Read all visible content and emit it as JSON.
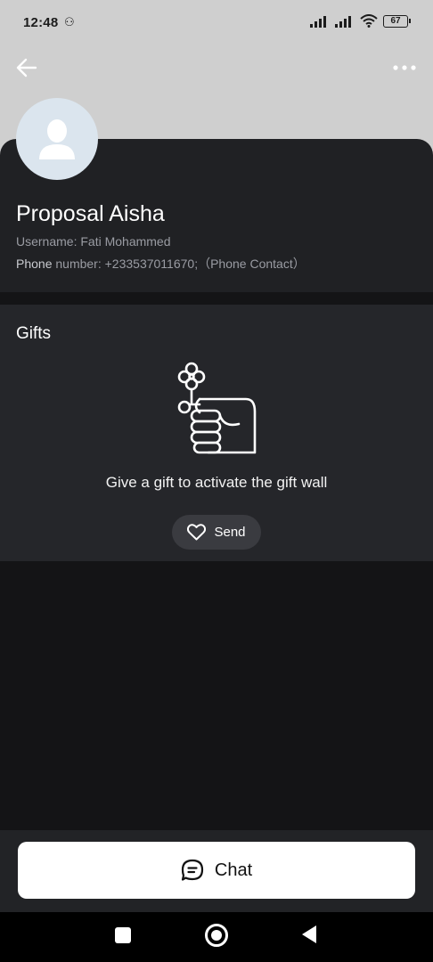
{
  "status_bar": {
    "time": "12:48",
    "battery": "67"
  },
  "header": {
    "back_icon": "arrow-left-icon",
    "more_icon": "more-horizontal-icon"
  },
  "profile": {
    "name": "Proposal Aisha",
    "username_label": "Username:",
    "username_value": "Fati Mohammed",
    "phone_label": "Phone",
    "phone_rest": "number: +233537011670;（Phone Contact）"
  },
  "gifts": {
    "title": "Gifts",
    "empty_text": "Give a gift to activate the gift wall",
    "send_label": "Send"
  },
  "bottom": {
    "chat_label": "Chat"
  },
  "colors": {
    "top_gray": "#cfcfcf",
    "card_bg": "#202124",
    "section_bg": "#25262a",
    "page_bg": "#141416",
    "button_white": "#ffffff"
  }
}
